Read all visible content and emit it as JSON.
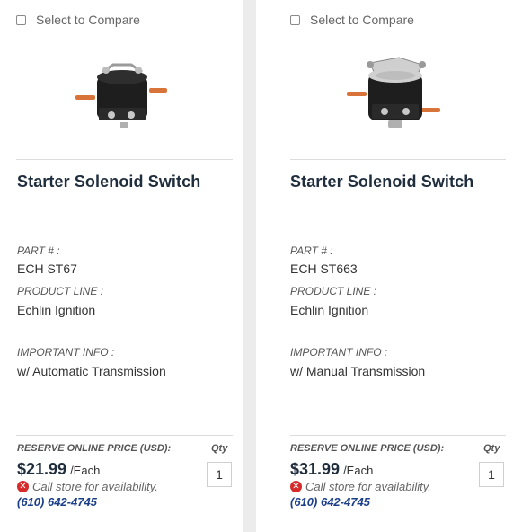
{
  "products": [
    {
      "compare_label": "Select to Compare",
      "image_icon": "solenoid-switch-image",
      "name": "Starter Solenoid Switch",
      "part_label": "PART # :",
      "part_value": "ECH ST67",
      "product_line_label": "PRODUCT LINE :",
      "product_line_value": "Echlin Ignition",
      "important_info_label": "IMPORTANT INFO :",
      "important_info_value": "w/ Automatic Transmission",
      "price_label": "RESERVE ONLINE PRICE (USD):",
      "qty_label": "Qty",
      "price": "$21.99",
      "unit": "/Each",
      "qty_value": "1",
      "availability": "Call store for availability.",
      "phone": "(610) 642-4745"
    },
    {
      "compare_label": "Select to Compare",
      "image_icon": "solenoid-switch-image",
      "name": "Starter Solenoid Switch",
      "part_label": "PART # :",
      "part_value": "ECH ST663",
      "product_line_label": "PRODUCT LINE :",
      "product_line_value": "Echlin Ignition",
      "important_info_label": "IMPORTANT INFO :",
      "important_info_value": "w/ Manual Transmission",
      "price_label": "RESERVE ONLINE PRICE (USD):",
      "qty_label": "Qty",
      "price": "$31.99",
      "unit": "/Each",
      "qty_value": "1",
      "availability": "Call store for availability.",
      "phone": "(610) 642-4745"
    }
  ],
  "colors": {
    "page_bg": "#ececec",
    "card_bg": "#ffffff",
    "title": "#1f2d3d",
    "error": "#d62b2b",
    "phone_link": "#1c3f8a"
  }
}
